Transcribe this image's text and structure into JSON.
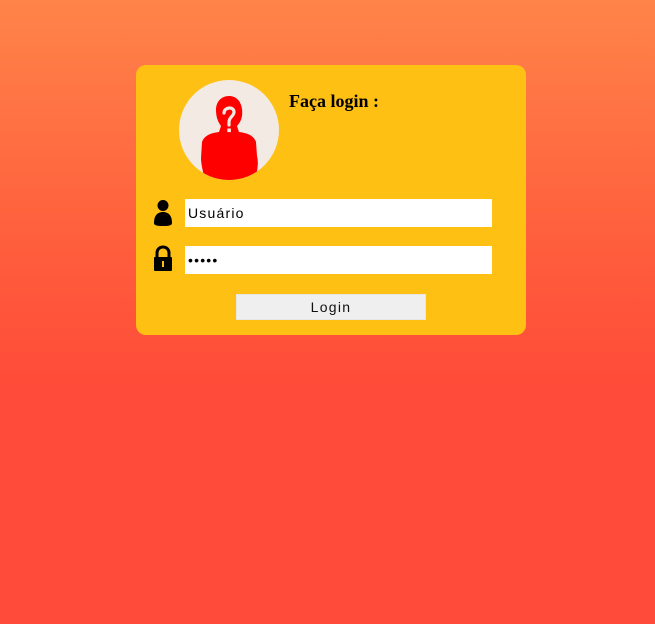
{
  "form": {
    "title": "Faça login :",
    "username": {
      "value": "",
      "placeholder": "Usuário"
    },
    "password": {
      "value": "•••••",
      "placeholder": ""
    },
    "login_label": "Login"
  },
  "icons": {
    "avatar": "unknown-user-icon",
    "username": "user-icon",
    "password": "padlock-icon"
  },
  "colors": {
    "card": "#ffc014",
    "avatar_bg": "#f3ebe3",
    "avatar_figure": "#ff0000",
    "background_top": "#ff8449",
    "background_bottom": "#ff4b39"
  }
}
